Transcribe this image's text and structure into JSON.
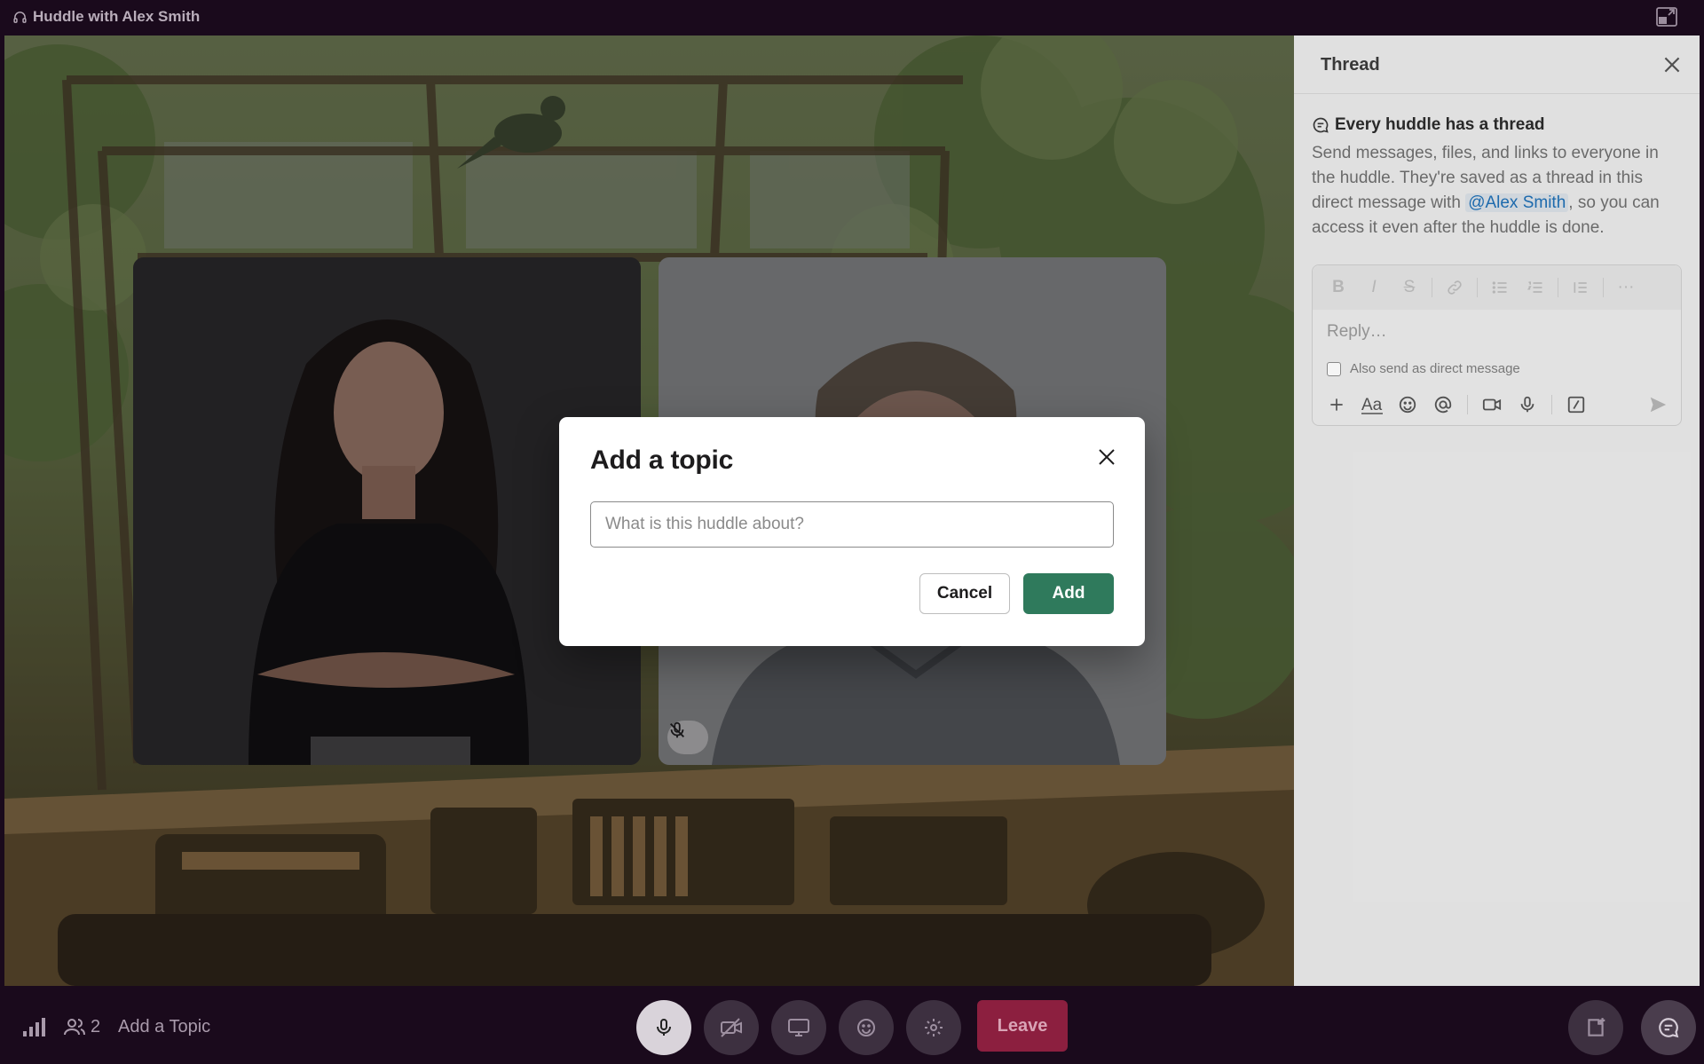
{
  "window": {
    "title": "Huddle with Alex Smith",
    "headphones_icon": "headphones-icon",
    "popout_icon": "popout-icon"
  },
  "modal": {
    "title": "Add a topic",
    "input_placeholder": "What is this huddle about?",
    "input_value": "",
    "cancel_label": "Cancel",
    "add_label": "Add",
    "accent_color": "#2f7a5c"
  },
  "thread_panel": {
    "title": "Thread",
    "info_heading": "Every huddle has a thread",
    "info_text_before": "Send messages, files, and links to everyone in the huddle. They're saved as a thread in this direct message with ",
    "mention": "@Alex Smith",
    "info_text_after": ", so you can access it even after the huddle is done.",
    "reply_placeholder": "Reply…",
    "also_send_label": "Also send as direct message",
    "formatting_icons": [
      "bold-icon",
      "italic-icon",
      "strikethrough-icon",
      "link-icon",
      "bulleted-list-icon",
      "numbered-list-icon",
      "blockquote-icon",
      "more-icon"
    ],
    "tool_icons": [
      "plus-icon",
      "text-format-icon",
      "emoji-icon",
      "mention-icon",
      "video-clip-icon",
      "audio-clip-icon",
      "slash-command-icon",
      "send-icon"
    ]
  },
  "bottom_bar": {
    "participant_count": "2",
    "add_topic_label": "Add a Topic",
    "leave_label": "Leave",
    "leave_color": "#8c1f3f",
    "controls": [
      "mic-icon",
      "video-off-icon",
      "screen-share-icon",
      "reaction-icon",
      "settings-icon"
    ]
  }
}
